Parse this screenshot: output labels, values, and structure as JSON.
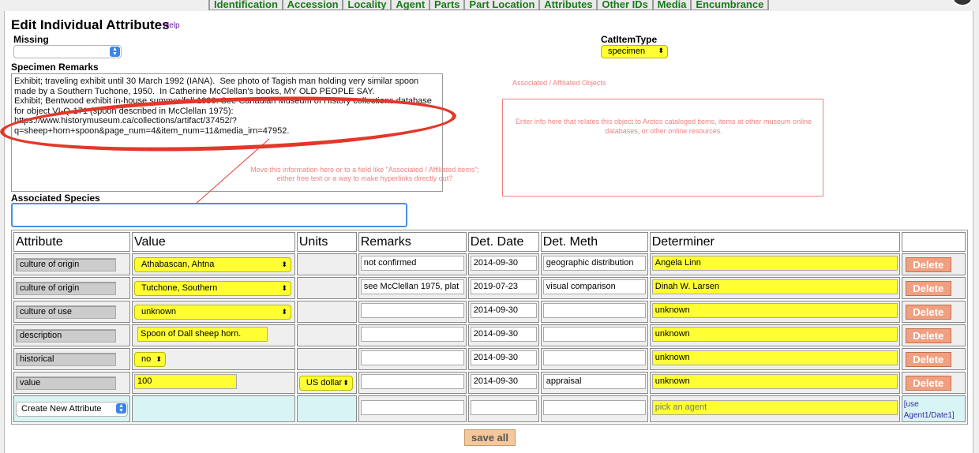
{
  "nav_tabs": [
    "Identification",
    "Accession",
    "Locality",
    "Agent",
    "Parts",
    "Part Location",
    "Attributes",
    "Other IDs",
    "Media",
    "Encumbrance"
  ],
  "page_title": "Edit Individual Attributes",
  "help_link": "Help",
  "missing": {
    "label": "Missing",
    "value": ""
  },
  "cat_item_type": {
    "label": "CatItemType",
    "value": "specimen"
  },
  "specimen_remarks": {
    "label": "Specimen Remarks",
    "text": "Exhibit; traveling exhibit until 30 March 1992 (IANA).  See photo of Tagish man holding very similar spoon made by a Southern Tuchone, 1950.  In Catherine McClellan's books, MY OLD PEOPLE SAY.\nExhibit; Bentwood exhibit in-house summer/fall 1990. See Canadian Museum of History collections database for object VI-Q-171 (spoon described in McClellan 1975):\nhttps://www.historymuseum.ca/collections/artifact/37452/?q=sheep+horn+spoon&page_num=4&item_num=11&media_irn=47952."
  },
  "annotations": {
    "assoc_title": "Associated / Affiliated Objects",
    "assoc_body": "Enter info here that relates this object to Arctos cataloged items, items at other museum online databases, or other online resources.",
    "move_note": "Move this information here or to a field like \"Associated / Affiliated items\"; either free text or a way to make hyperlinks directly out?"
  },
  "associated_species": {
    "label": "Associated Species",
    "value": ""
  },
  "table": {
    "headers": [
      "Attribute",
      "Value",
      "Units",
      "Remarks",
      "Det. Date",
      "Det. Meth",
      "Determiner",
      ""
    ],
    "rows": [
      {
        "attribute": "culture of origin",
        "value": "Athabascan, Ahtna",
        "value_type": "select",
        "units": "",
        "remarks": "not confirmed",
        "det_date": "2014-09-30",
        "det_meth": "geographic distribution",
        "determiner": "Angela Linn",
        "action": "Delete"
      },
      {
        "attribute": "culture of origin",
        "value": "Tutchone, Southern",
        "value_type": "select",
        "units": "",
        "remarks": "see McClellan 1975, plat",
        "det_date": "2019-07-23",
        "det_meth": "visual comparison",
        "determiner": "Dinah W. Larsen",
        "action": "Delete"
      },
      {
        "attribute": "culture of use",
        "value": "unknown",
        "value_type": "select",
        "units": "",
        "remarks": "",
        "det_date": "2014-09-30",
        "det_meth": "",
        "determiner": "unknown",
        "action": "Delete"
      },
      {
        "attribute": "description",
        "value": "Spoon of Dall sheep horn.",
        "value_type": "textarea",
        "units": "",
        "remarks": "",
        "det_date": "2014-09-30",
        "det_meth": "",
        "determiner": "unknown",
        "action": "Delete"
      },
      {
        "attribute": "historical",
        "value": "no",
        "value_type": "smallselect",
        "units": "",
        "remarks": "",
        "det_date": "2014-09-30",
        "det_meth": "",
        "determiner": "unknown",
        "action": "Delete"
      },
      {
        "attribute": "value",
        "value": "100",
        "value_type": "input",
        "units": "US dollar",
        "remarks": "",
        "det_date": "2014-09-30",
        "det_meth": "appraisal",
        "determiner": "unknown",
        "action": "Delete"
      }
    ],
    "new_row": {
      "attribute_select": "Create New Attribute",
      "determiner_placeholder": "pick an agent",
      "use_link": "[use Agent1/Date1]"
    }
  },
  "save_all": "save all"
}
